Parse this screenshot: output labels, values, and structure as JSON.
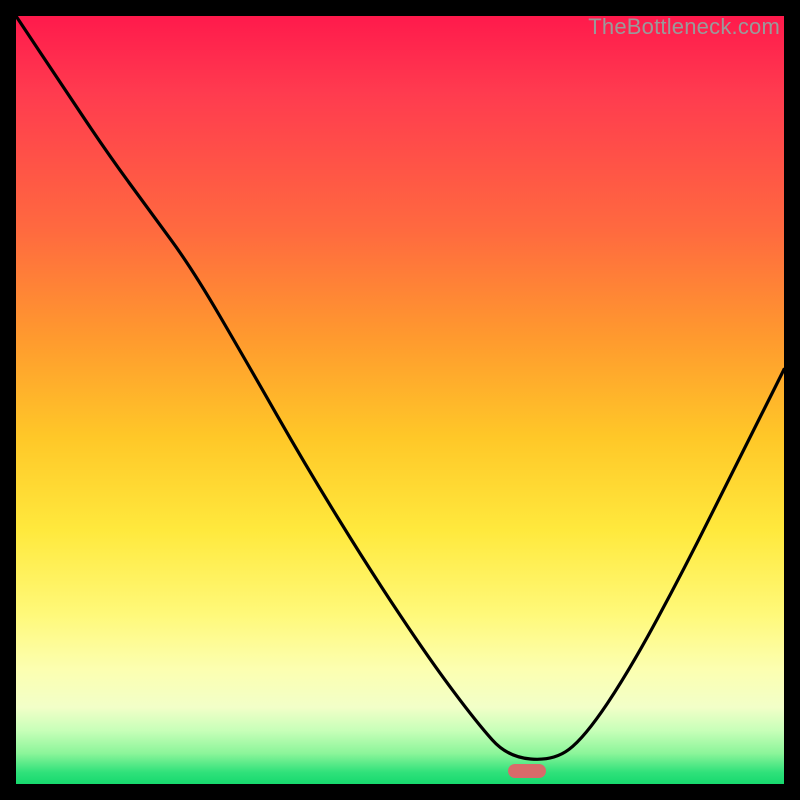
{
  "watermark": {
    "text": "TheBottleneck.com"
  },
  "marker": {
    "x_frac": 0.665,
    "y_frac": 0.983,
    "color": "#d96a6a"
  },
  "chart_data": {
    "type": "line",
    "title": "",
    "xlabel": "",
    "ylabel": "",
    "xlim": [
      0,
      1
    ],
    "ylim": [
      0,
      1
    ],
    "grid": false,
    "legend": false,
    "notes": "Unlabeled V-curve over a vertical red→green heat gradient. No axes, ticks, or numeric labels are shown in the image; x/y values below are fractional positions within the plot area (0=left/top edge, 1=right/bottom edge along each axis as displayed). A single rounded horizontal marker sits at the valley.",
    "series": [
      {
        "name": "curve",
        "x": [
          0.0,
          0.06,
          0.12,
          0.175,
          0.23,
          0.3,
          0.38,
          0.46,
          0.54,
          0.6,
          0.64,
          0.7,
          0.74,
          0.8,
          0.87,
          0.94,
          1.0
        ],
        "y": [
          0.0,
          0.09,
          0.18,
          0.255,
          0.33,
          0.45,
          0.59,
          0.72,
          0.84,
          0.92,
          0.965,
          0.97,
          0.94,
          0.85,
          0.72,
          0.58,
          0.46
        ]
      }
    ],
    "marker_point": {
      "x": 0.665,
      "y": 0.983
    }
  }
}
